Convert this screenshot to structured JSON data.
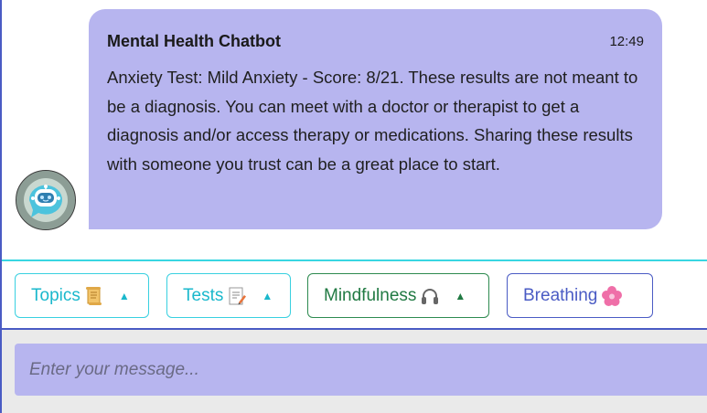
{
  "chat": {
    "sender": "Mental Health Chatbot",
    "time": "12:49",
    "message": "Anxiety Test: Mild Anxiety - Score: 8/21. These results are not meant to be a diagnosis. You can meet with a doctor or therapist to get a diagnosis and/or access therapy or medications. Sharing these results with someone you trust can be a great place to start.",
    "avatar_icon": "robot-avatar-icon"
  },
  "menu": {
    "topics_label": "Topics",
    "topics_icon": "scroll-icon",
    "tests_label": "Tests",
    "tests_icon": "memo-icon",
    "mindfulness_label": "Mindfulness",
    "mindfulness_icon": "headphones-icon",
    "breathing_label": "Breathing",
    "breathing_icon": "flower-icon"
  },
  "input": {
    "placeholder": "Enter your message..."
  },
  "colors": {
    "bubble": "#b7b5ef",
    "accent_cyan": "#38d0e0",
    "accent_green": "#2d8a4f",
    "accent_blue": "#4a5bc4"
  }
}
